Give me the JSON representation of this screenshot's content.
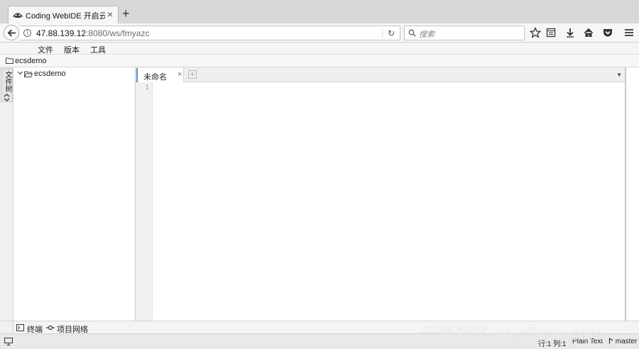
{
  "browser": {
    "tab_title": "Coding WebIDE 开启云端开发模式",
    "tab_close": "×",
    "new_tab": "+",
    "url_host": "47.88.139.12",
    "url_rest": ":8080/ws/fmyazc",
    "reload_glyph": "↻",
    "search_placeholder": "搜索",
    "icons": [
      "back-icon",
      "info-icon",
      "reload-icon",
      "search-icon",
      "bookmark-star-icon",
      "reading-list-icon",
      "download-icon",
      "home-icon",
      "pocket-icon",
      "hamburger-menu-icon"
    ]
  },
  "menubar": {
    "file": "文件",
    "version": "版本",
    "tools": "工具"
  },
  "breadcrumb": {
    "workspace": "ecsdemo"
  },
  "sidebar": {
    "tab_label": "文件树",
    "tab_arrows": "⌃⌄"
  },
  "filetree": {
    "root": "ecsdemo",
    "chevron": "∨"
  },
  "editor": {
    "tab_label": "未命名",
    "tab_close": "×",
    "add_tab": "+",
    "menu_glyph": "▼",
    "line_numbers": [
      "1"
    ]
  },
  "bottom_panel": {
    "terminal": "终端",
    "network": "项目网络"
  },
  "statusbar": {
    "position": "行:1 列:1",
    "mode": "Plain Text",
    "branch": "master"
  },
  "watermark": "云栖社区 yq.aliyun.com",
  "colors": {
    "tab_strip": "#d7d7d7",
    "active_tab_accent": "#4a90d9",
    "status_bar": "#e9e9e9"
  }
}
